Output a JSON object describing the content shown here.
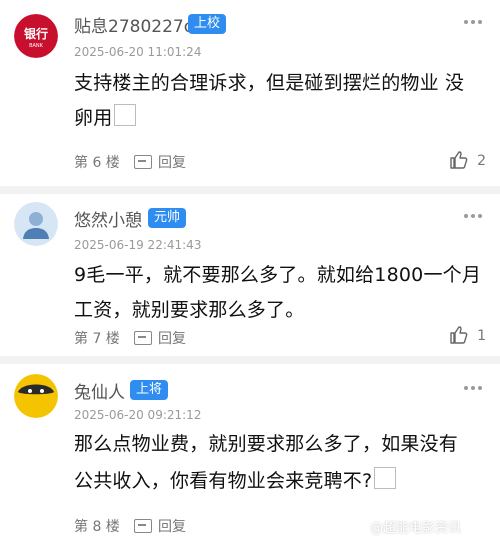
{
  "comments": [
    {
      "username": "贴息2780227o",
      "rank": "上校",
      "time": "2025-06-20 11:01:24",
      "text_line1": "支持楼主的合理诉求，但是碰到摆烂的物业 没",
      "text_line2": "卵用",
      "floor": "第 6 楼",
      "reply": "回复",
      "likes": "2",
      "avatar_icon": "bank-logo-icon",
      "avatar_text": "银行",
      "avatar_subtext": "BANK"
    },
    {
      "username": "悠然小憩",
      "rank": "元帅",
      "time": "2025-06-19 22:41:43",
      "text_line1": "9毛一平，就不要那么多了。就如给1800一个月",
      "text_line2": "工资，就别要求那么多了。",
      "floor": "第 7 楼",
      "reply": "回复",
      "likes": "1",
      "avatar_icon": "default-user-icon"
    },
    {
      "username": "兔仙人",
      "rank": "上将",
      "time": "2025-06-20 09:21:12",
      "text_line1": "那么点物业费，就别要求那么多了，如果没有",
      "text_line2": "公共收入，你看有物业会来竞聘不?",
      "floor": "第 8 楼",
      "reply": "回复",
      "likes": "",
      "avatar_icon": "yellow-face-icon"
    }
  ],
  "watermark": "@超能电影资讯",
  "colors": {
    "rank_badge": "#2f8cf0",
    "divider": "#f2f2f2",
    "muted": "#9a9a9a"
  }
}
